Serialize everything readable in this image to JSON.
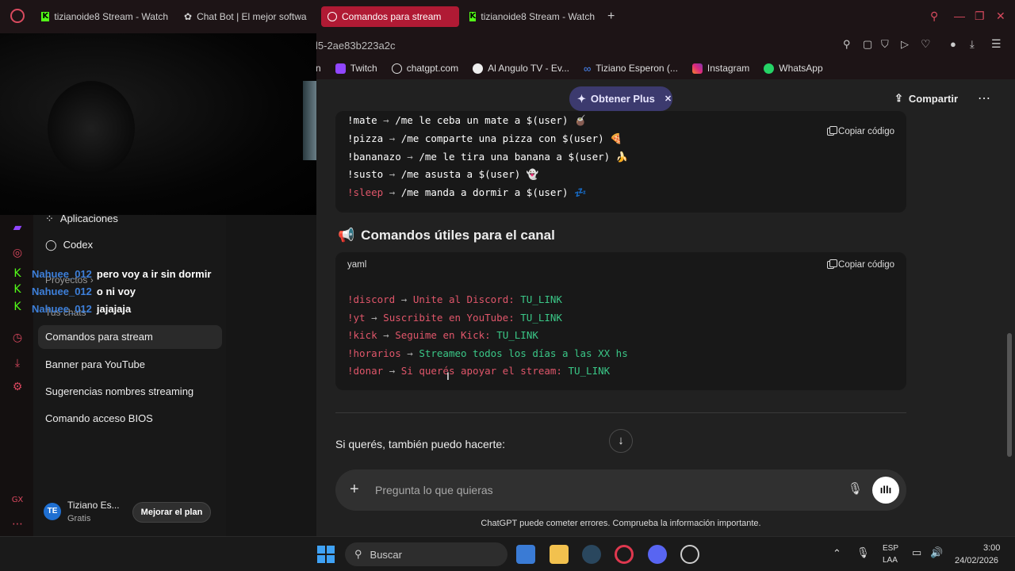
{
  "browser": {
    "tabs": [
      {
        "label": "tizianoide8 Stream - Watch",
        "icon": "kick-icon",
        "active": false
      },
      {
        "label": "Chat Bot | El mejor softwa",
        "icon": "chatbot-icon",
        "active": false
      },
      {
        "label": "Comandos para stream",
        "icon": "chatgpt-icon",
        "active": true
      },
      {
        "label": "tizianoide8 Stream - Watch",
        "icon": "kick-icon",
        "active": false
      }
    ],
    "url_fragment": "l5-2ae83b223a2c",
    "bookmarks": [
      {
        "label": "n",
        "icon": ""
      },
      {
        "label": "Twitch",
        "icon": "twitch-icon"
      },
      {
        "label": "chatgpt.com",
        "icon": "chatgpt-icon"
      },
      {
        "label": "Al Angulo TV - Ev...",
        "icon": "soccer-icon"
      },
      {
        "label": "Tiziano Esperon (...",
        "icon": "meta-icon"
      },
      {
        "label": "Instagram",
        "icon": "instagram-icon"
      },
      {
        "label": "WhatsApp",
        "icon": "whatsapp-icon"
      }
    ]
  },
  "chatgpt": {
    "get_plus": "Obtener Plus",
    "share": "Compartir",
    "sidebar": {
      "apps": "Aplicaciones",
      "codex": "Codex",
      "projects": "Proyectos",
      "your_chats": "Tus chats",
      "chats": [
        "Comandos para stream",
        "Banner para YouTube",
        "Sugerencias nombres streaming",
        "Comando acceso BIOS"
      ],
      "user_initials": "TE",
      "user_name": "Tiziano Es...",
      "user_plan": "Gratis",
      "upgrade": "Mejorar el plan"
    },
    "code_block_1": {
      "copy": "Copiar código",
      "lines": [
        {
          "cmd": "!mate",
          "text": "/me le ceba un mate a $(user)",
          "emoji": "🧉"
        },
        {
          "cmd": "!pizza",
          "text": "/me comparte una pizza con $(user)",
          "emoji": "🍕"
        },
        {
          "cmd": "!bananazo",
          "text": "/me le tira una banana a $(user)",
          "emoji": "🍌"
        },
        {
          "cmd": "!susto",
          "text": "/me asusta a $(user)",
          "emoji": "👻"
        },
        {
          "cmd": "!sleep",
          "text": "/me manda a dormir a $(user)",
          "emoji": "💤"
        }
      ]
    },
    "section_heading": "Comandos útiles para el canal",
    "section_emoji": "📢",
    "code_block_2": {
      "lang": "yaml",
      "copy": "Copiar código",
      "lines": [
        {
          "cmd": "!discord",
          "text": "Unite al Discord:",
          "link": "TU_LINK"
        },
        {
          "cmd": "!yt",
          "text": "Suscribite en YouTube:",
          "link": "TU_LINK"
        },
        {
          "cmd": "!kick",
          "text": "Seguime en Kick:",
          "link": "TU_LINK"
        },
        {
          "cmd": "!horarios",
          "text": "Streameo todos los días a las XX hs",
          "link": ""
        },
        {
          "cmd": "!donar",
          "text": "Si querés apoyar el stream:",
          "link": "TU_LINK"
        }
      ]
    },
    "followup": "Si querés, también puedo hacerte:",
    "input_placeholder": "Pregunta lo que quieras",
    "disclaimer": "ChatGPT puede cometer errores. Comprueba la información importante."
  },
  "stream_chat": [
    {
      "user": "Nahuee_012",
      "msg": "pero voy a ir sin dormir"
    },
    {
      "user": "Nahuee_012",
      "msg": "o ni voy"
    },
    {
      "user": "Nahuee_012",
      "msg": "jajajaja"
    }
  ],
  "taskbar": {
    "search": "Buscar",
    "lang_top": "ESP",
    "lang_bottom": "LAA",
    "time": "3:00",
    "date": "24/02/2026"
  },
  "colors": {
    "opera_red": "#d84a5e",
    "kick_green": "#53fc18",
    "active_tab": "#b01a34",
    "link_green": "#3ac787",
    "chat_user_blue": "#3d7fd9"
  }
}
